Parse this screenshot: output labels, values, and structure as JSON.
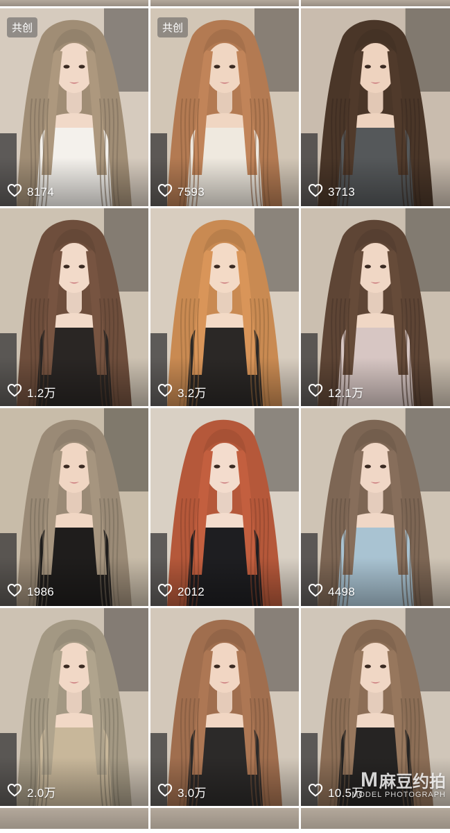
{
  "feed": {
    "rows": [
      {
        "tiles": [
          {
            "id": "t1",
            "badge": "共创",
            "likes": "8174",
            "hair": "#a08d75",
            "bg": "#d6cbbe",
            "top": "#f4f1ec",
            "skin": "#f1d9c8"
          },
          {
            "id": "t2",
            "badge": "共创",
            "likes": "7593",
            "hair": "#b37a52",
            "bg": "#d2c6b6",
            "top": "#efe9df",
            "skin": "#f0d6c2"
          },
          {
            "id": "t3",
            "badge": "",
            "likes": "3713",
            "hair": "#4a3628",
            "bg": "#c9bcae",
            "top": "#55585a",
            "skin": "#eed3bf"
          }
        ]
      },
      {
        "tiles": [
          {
            "id": "t4",
            "badge": "",
            "likes": "1.2万",
            "hair": "#6e4e3c",
            "bg": "#cdc2b2",
            "top": "#2a2624",
            "skin": "#f2dac9"
          },
          {
            "id": "t5",
            "badge": "",
            "likes": "3.2万",
            "hair": "#c98a52",
            "bg": "#d8cdbf",
            "top": "#2b2826",
            "skin": "#f3dac6"
          },
          {
            "id": "t6",
            "badge": "",
            "likes": "12.1万",
            "hair": "#5e4535",
            "bg": "#cbbfb0",
            "top": "#d7c6c3",
            "skin": "#f0d7c5"
          }
        ]
      },
      {
        "tiles": [
          {
            "id": "t7",
            "badge": "",
            "likes": "1986",
            "hair": "#9a8a76",
            "bg": "#c8bca9",
            "top": "#1f1d1c",
            "skin": "#f0d6c3"
          },
          {
            "id": "t8",
            "badge": "",
            "likes": "2012",
            "hair": "#b5583a",
            "bg": "#d9d0c4",
            "top": "#1e1e21",
            "skin": "#f3dccd"
          },
          {
            "id": "t9",
            "badge": "",
            "likes": "4498",
            "hair": "#7d6654",
            "bg": "#cfc4b5",
            "top": "#a9c3d2",
            "skin": "#f0d7c6"
          }
        ]
      },
      {
        "tiles": [
          {
            "id": "t10",
            "badge": "",
            "likes": "2.0万",
            "hair": "#a39883",
            "bg": "#cdc2b3",
            "top": "#c8b79a",
            "skin": "#f1d8c6"
          },
          {
            "id": "t11",
            "badge": "",
            "likes": "3.0万",
            "hair": "#a06e4e",
            "bg": "#d3c8ba",
            "top": "#2c2a29",
            "skin": "#f1d6c3"
          },
          {
            "id": "t12",
            "badge": "",
            "likes": "10.5万",
            "hair": "#8c6e56",
            "bg": "#d0c6b9",
            "top": "#262423",
            "skin": "#f0d7c5"
          }
        ]
      }
    ]
  },
  "watermark": {
    "mark": "M",
    "brand": "麻豆约拍",
    "subtitle": "MODEL PHOTOGRAPH"
  },
  "icons": {
    "like": "heart-outline-icon"
  }
}
